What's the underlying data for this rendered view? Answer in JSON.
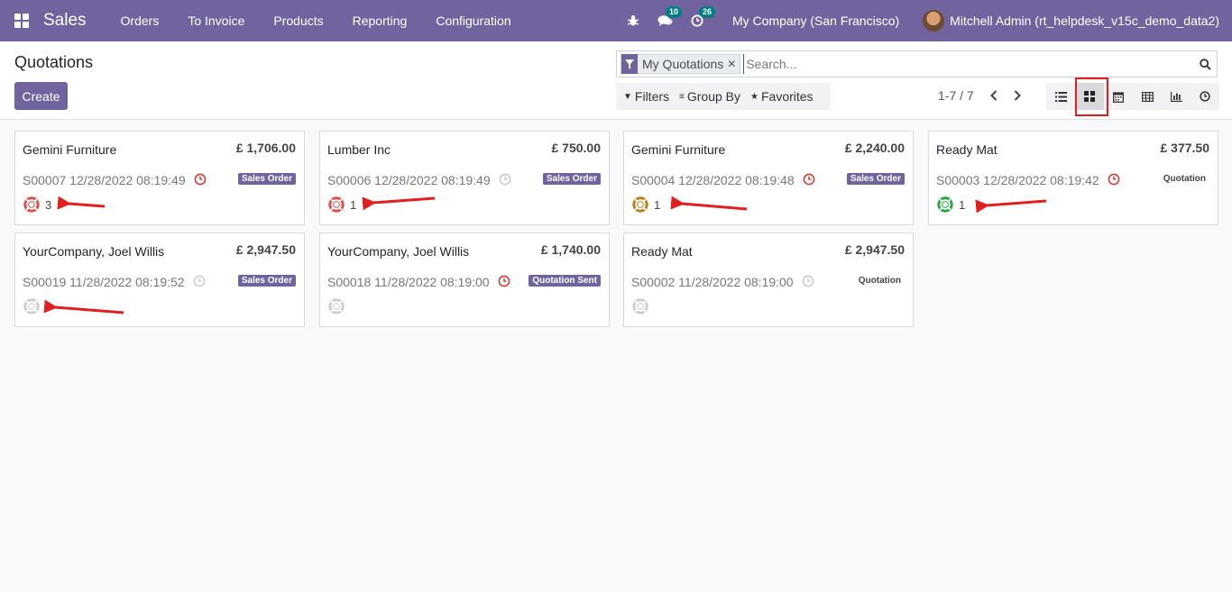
{
  "navbar": {
    "app_name": "Sales",
    "menu": [
      "Orders",
      "To Invoice",
      "Products",
      "Reporting",
      "Configuration"
    ],
    "messages_count": "10",
    "activities_count": "26",
    "company": "My Company (San Francisco)",
    "user": "Mitchell Admin (rt_helpdesk_v15c_demo_data2)"
  },
  "control_panel": {
    "title": "Quotations",
    "create_label": "Create",
    "facet_label": "My Quotations",
    "search_placeholder": "Search...",
    "filters_label": "Filters",
    "group_by_label": "Group By",
    "favorites_label": "Favorites",
    "pager": "1-7 / 7",
    "views": [
      "list",
      "kanban",
      "calendar",
      "pivot",
      "graph",
      "activity"
    ],
    "active_view": "kanban"
  },
  "cards": [
    {
      "customer": "Gemini Furniture",
      "amount": "£ 1,706.00",
      "ref": "S00007 12/28/2022 08:19:49",
      "clock": "red",
      "status": "Sales Order",
      "status_style": "purple",
      "ticket_color": "red",
      "ticket_count": "3"
    },
    {
      "customer": "Lumber Inc",
      "amount": "£ 750.00",
      "ref": "S00006 12/28/2022 08:19:49",
      "clock": "grey",
      "status": "Sales Order",
      "status_style": "purple",
      "ticket_color": "red",
      "ticket_count": "1"
    },
    {
      "customer": "Gemini Furniture",
      "amount": "£ 2,240.00",
      "ref": "S00004 12/28/2022 08:19:48",
      "clock": "red",
      "status": "Sales Order",
      "status_style": "purple",
      "ticket_color": "orange",
      "ticket_count": "1"
    },
    {
      "customer": "Ready Mat",
      "amount": "£ 377.50",
      "ref": "S00003 12/28/2022 08:19:42",
      "clock": "red",
      "status": "Quotation",
      "status_style": "plain",
      "ticket_color": "green",
      "ticket_count": "1"
    },
    {
      "customer": "YourCompany, Joel Willis",
      "amount": "£ 2,947.50",
      "ref": "S00019 11/28/2022 08:19:52",
      "clock": "grey",
      "status": "Sales Order",
      "status_style": "purple",
      "ticket_color": "grey",
      "ticket_count": ""
    },
    {
      "customer": "YourCompany, Joel Willis",
      "amount": "£ 1,740.00",
      "ref": "S00018 11/28/2022 08:19:00",
      "clock": "red",
      "status": "Quotation Sent",
      "status_style": "purple",
      "ticket_color": "grey",
      "ticket_count": ""
    },
    {
      "customer": "Ready Mat",
      "amount": "£ 2,947.50",
      "ref": "S00002 11/28/2022 08:19:00",
      "clock": "grey",
      "status": "Quotation",
      "status_style": "plain",
      "ticket_color": "grey",
      "ticket_count": ""
    }
  ],
  "colors": {
    "brand": "#71639e",
    "clock_red": "#d23f3a",
    "clock_grey": "#cccccc",
    "ticket_red": "#d9534f",
    "ticket_orange": "#b7821b",
    "ticket_green": "#28a745",
    "ticket_grey": "#cfcfcf",
    "annotation_red": "#e02020"
  }
}
